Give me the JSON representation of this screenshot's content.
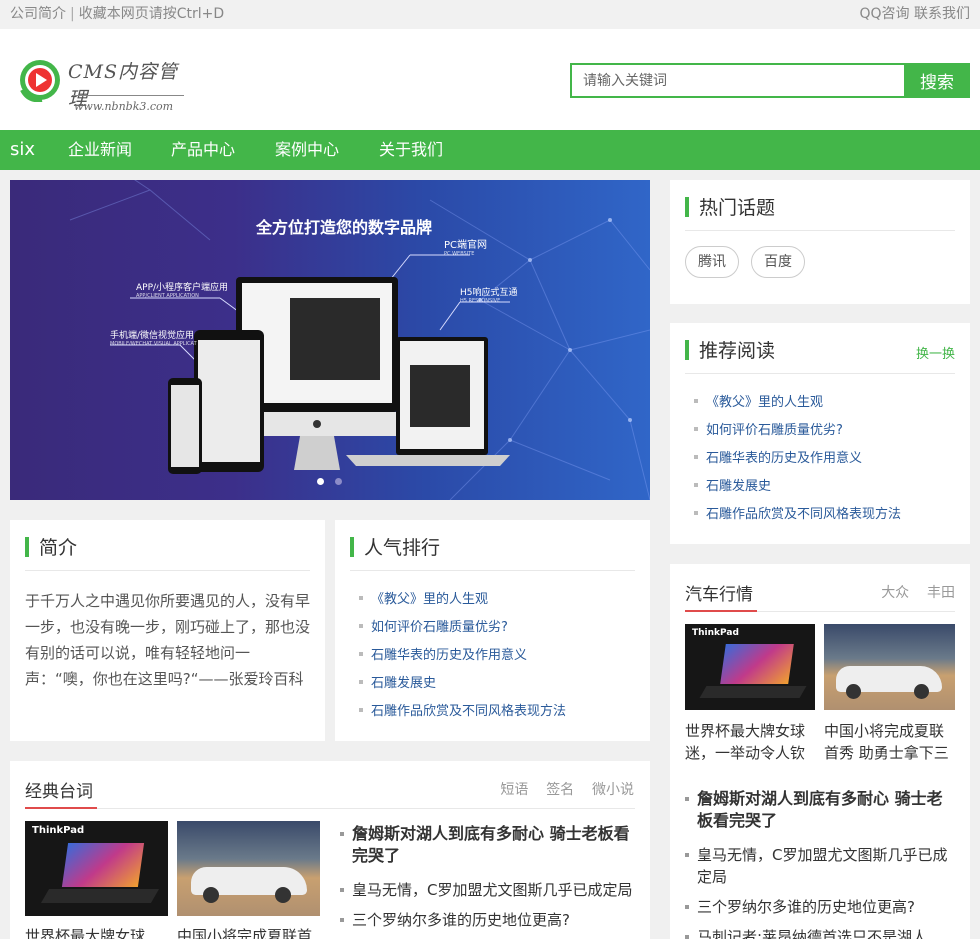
{
  "topbar": {
    "company_intro": "公司简介",
    "bookmark_hint": "收藏本网页请按Ctrl+D",
    "qq": "QQ咨询",
    "contact": "联系我们"
  },
  "logo": {
    "brand": "CMS内容管理",
    "url": "www.nbnbk3.com"
  },
  "search": {
    "placeholder": "请输入关键词",
    "button": "搜索"
  },
  "nav": {
    "items": [
      "six",
      "企业新闻",
      "产品中心",
      "案例中心",
      "关于我们"
    ]
  },
  "slider": {
    "headline": "全方位打造您的数字品牌",
    "labels": [
      {
        "cn": "PC端官网",
        "en": "PC WEBSITE"
      },
      {
        "cn": "APP/小程序客户端应用",
        "en": "APP/CLIENT APPLICATION"
      },
      {
        "cn": "H5响应式互通",
        "en": "H5 RESPONSIVE"
      },
      {
        "cn": "手机端/微信视觉应用",
        "en": "MOBILE/WECHAT VISUAL APPLICAT"
      }
    ]
  },
  "intro": {
    "title": "简介",
    "text": "于千万人之中遇见你所要遇见的人，没有早一步，也没有晚一步，刚巧碰上了，那也没有别的话可以说，唯有轻轻地问一声：“噢，你也在这里吗?“——张爱玲百科"
  },
  "ranking": {
    "title": "人气排行",
    "items": [
      "《教父》里的人生观",
      "如何评价石雕质量优劣?",
      "石雕华表的历史及作用意义",
      "石雕发展史",
      "石雕作品欣赏及不同风格表现方法"
    ]
  },
  "hot_topics": {
    "title": "热门话题",
    "tags": [
      "腾讯",
      "百度"
    ]
  },
  "recommend": {
    "title": "推荐阅读",
    "refresh": "换一换",
    "items": [
      "《教父》里的人生观",
      "如何评价石雕质量优劣?",
      "石雕华表的历史及作用意义",
      "石雕发展史",
      "石雕作品欣赏及不同风格表现方法"
    ]
  },
  "classic": {
    "title": "经典台词",
    "tabs": [
      "短语",
      "签名",
      "微小说"
    ],
    "cards": [
      "世界杯最大牌女球迷，一举动令人钦",
      "中国小将完成夏联首秀 助勇士拿下三"
    ],
    "news": [
      "詹姆斯对湖人到底有多耐心 骑士老板看完哭了",
      "皇马无情，C罗加盟尤文图斯几乎已成定局",
      "三个罗纳尔多谁的历史地位更高?"
    ]
  },
  "auto": {
    "title": "汽车行情",
    "tabs": [
      "大众",
      "丰田"
    ],
    "cards": [
      "世界杯最大牌女球迷，一举动令人钦",
      "中国小将完成夏联首秀 助勇士拿下三"
    ],
    "news": [
      "詹姆斯对湖人到底有多耐心 骑士老板看完哭了",
      "皇马无情，C罗加盟尤文图斯几乎已成定局",
      "三个罗纳尔多谁的历史地位更高?",
      "马刺记者:莱昂纳德首选只不是湖人"
    ]
  },
  "thumbs": {
    "laptop_brand": "ThinkPad"
  },
  "colors": {
    "accent": "#43b649",
    "tab_underline": "#e04b4b",
    "link": "#2a5a9a"
  }
}
